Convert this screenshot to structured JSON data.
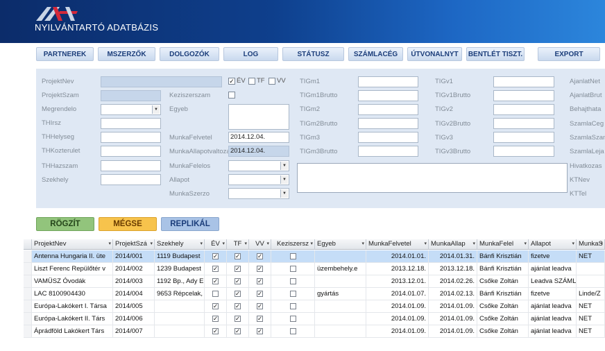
{
  "app": {
    "title": "NYILVÁNTARTÓ ADATBÁZIS"
  },
  "colors": {
    "header_dark": "#0c2c6a",
    "header_light": "#2c86dc",
    "panel": "#dfe8f4",
    "rogzit": "#92c47c",
    "megse": "#f7c34c",
    "replikal": "#a9c3e6",
    "selected_row": "#c5ddf7"
  },
  "nav": [
    "PARTNEREK",
    "MSZERZŐK",
    "DOLGOZÓK",
    "LOG",
    "STÁTUSZ",
    "SZÁMLACÉG",
    "ÚTVONALNYT",
    "BENTLÉT TISZT.",
    "EXPORT"
  ],
  "form": {
    "left_labels": [
      "ProjektNev",
      "ProjektSzam",
      "Megrendelo",
      "THIrsz",
      "THHelyseg",
      "THKozterulet",
      "THHazszam",
      "Szekhely"
    ],
    "mid_labels": [
      "Keziszerszam",
      "Egyeb",
      "MunkaFelvetel",
      "MunkaAllapotvaltozas",
      "MunkaFelelos",
      "Allapot",
      "MunkaSzerzo"
    ],
    "munkafelvetel": "2014.12.04.",
    "munkaallapotvaltozas": "2014.12.04.",
    "flags": [
      "ÉV",
      "TF",
      "VV"
    ],
    "tig_labels": [
      "TIGm1",
      "TIGm1Brutto",
      "TIGm2",
      "TIGm2Brutto",
      "TIGm3",
      "TIGm3Brutto"
    ],
    "tigv_labels": [
      "TIGv1",
      "TIGv1Brutto",
      "TIGv2",
      "TIGv2Brutto",
      "TIGv3",
      "TIGv3Brutto"
    ],
    "right_labels": [
      "AjanlatNet",
      "AjanlatBrut",
      "Behajthata",
      "SzamlaCeg",
      "SzamlaSzam",
      "SzamlaLeja",
      "Hivatkozas",
      "KTNev",
      "KTTel"
    ]
  },
  "actions": {
    "save": "RÖGZÍT",
    "cancel": "MÉGSE",
    "replicate": "REPLIKÁL"
  },
  "grid": {
    "headers": [
      "ProjektNev",
      "ProjektSzá",
      "Szekhely",
      "ÉV",
      "TF",
      "VV",
      "Keziszersz",
      "Egyeb",
      "MunkaFelvetel",
      "MunkaAllap",
      "MunkaFelel",
      "Allapot",
      "MunkaS"
    ],
    "rows": [
      {
        "name": "Antenna Hungaria II. üte",
        "szam": "2014/001",
        "szekhely": "1119 Budapest",
        "ev": true,
        "tf": true,
        "vv": true,
        "kezi": false,
        "egyeb": "",
        "felvetel": "2014.01.01.",
        "allapotvalt": "2014.01.31.",
        "felelos": "Bánfi Krisztián",
        "allapot": "fizetve",
        "szerzo": "NET"
      },
      {
        "name": "Liszt Ferenc Repülőtér v",
        "szam": "2014/002",
        "szekhely": "1239 Budapest",
        "ev": true,
        "tf": true,
        "vv": true,
        "kezi": false,
        "egyeb": "üzembehely.e",
        "felvetel": "2013.12.18.",
        "allapotvalt": "2013.12.18.",
        "felelos": "Bánfi Krisztián",
        "allapot": "ajánlat leadva",
        "szerzo": ""
      },
      {
        "name": "VAMÜSZ Óvodák",
        "szam": "2014/003",
        "szekhely": "1192 Bp., Ady E",
        "ev": true,
        "tf": true,
        "vv": true,
        "kezi": false,
        "egyeb": "",
        "felvetel": "2013.12.01.",
        "allapotvalt": "2014.02.26.",
        "felelos": "Csőke Zoltán",
        "allapot": "Leadva SZÁML",
        "szerzo": ""
      },
      {
        "name": "LAC 8100904430",
        "szam": "2014/004",
        "szekhely": "9653 Répcelak,",
        "ev": false,
        "tf": true,
        "vv": true,
        "kezi": false,
        "egyeb": "gyártás",
        "felvetel": "2014.01.07.",
        "allapotvalt": "2014.02.13.",
        "felelos": "Bánfi Krisztián",
        "allapot": "fizetve",
        "szerzo": "Linde/Z"
      },
      {
        "name": "Európa-Lakókert I. Társa",
        "szam": "2014/005",
        "szekhely": "",
        "ev": true,
        "tf": true,
        "vv": true,
        "kezi": false,
        "egyeb": "",
        "felvetel": "2014.01.09.",
        "allapotvalt": "2014.01.09.",
        "felelos": "Csőke Zoltán",
        "allapot": "ajánlat leadva",
        "szerzo": "NET"
      },
      {
        "name": "Európa-Lakókert II. Társ",
        "szam": "2014/006",
        "szekhely": "",
        "ev": true,
        "tf": true,
        "vv": true,
        "kezi": false,
        "egyeb": "",
        "felvetel": "2014.01.09.",
        "allapotvalt": "2014.01.09.",
        "felelos": "Csőke Zoltán",
        "allapot": "ajánlat leadva",
        "szerzo": "NET"
      },
      {
        "name": "Áprádföld Lakókert Társ",
        "szam": "2014/007",
        "szekhely": "",
        "ev": true,
        "tf": true,
        "vv": true,
        "kezi": false,
        "egyeb": "",
        "felvetel": "2014.01.09.",
        "allapotvalt": "2014.01.09.",
        "felelos": "Csőke Zoltán",
        "allapot": "ajánlat leadva",
        "szerzo": "NET"
      }
    ]
  }
}
